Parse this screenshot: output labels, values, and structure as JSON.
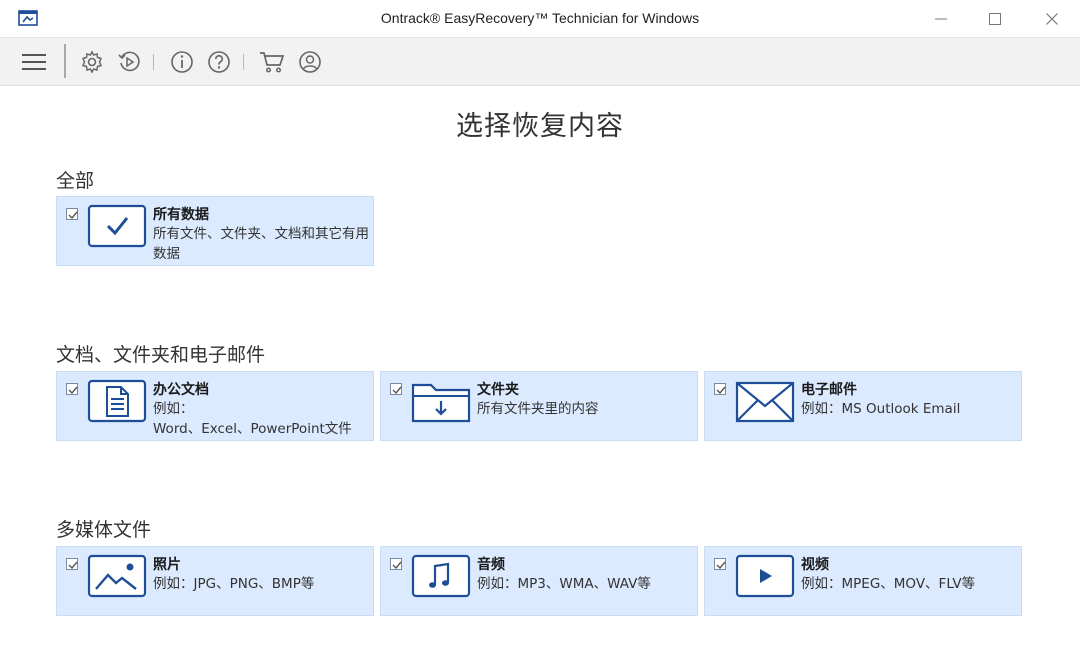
{
  "window": {
    "title": "Ontrack® EasyRecovery™ Technician for Windows"
  },
  "toolbar": {
    "items": [
      "menu-icon",
      "settings-icon",
      "history-icon",
      "info-icon",
      "help-icon",
      "cart-icon",
      "account-icon"
    ]
  },
  "page": {
    "title": "选择恢复内容"
  },
  "sections": [
    {
      "title": "全部",
      "cards": [
        {
          "title": "所有数据",
          "desc": "所有文件、文件夹、文档和其它有用数据",
          "checked": true,
          "icon": "check-icon"
        }
      ]
    },
    {
      "title": "文档、文件夹和电子邮件",
      "cards": [
        {
          "title": "办公文档",
          "desc_line1": "例如：",
          "desc_line2": "Word、Excel、PowerPoint文件",
          "checked": true,
          "icon": "document-icon"
        },
        {
          "title": "文件夹",
          "desc": "所有文件夹里的内容",
          "checked": true,
          "icon": "folder-icon"
        },
        {
          "title": "电子邮件",
          "desc": "例如：MS Outlook Email",
          "checked": true,
          "icon": "envelope-icon"
        }
      ]
    },
    {
      "title": "多媒体文件",
      "cards": [
        {
          "title": "照片",
          "desc": "例如：JPG、PNG、BMP等",
          "checked": true,
          "icon": "image-icon"
        },
        {
          "title": "音频",
          "desc": "例如：MP3、WMA、WAV等",
          "checked": true,
          "icon": "music-icon"
        },
        {
          "title": "视频",
          "desc": "例如：MPEG、MOV、FLV等",
          "checked": true,
          "icon": "play-icon"
        }
      ]
    }
  ],
  "colors": {
    "card_bg": "#dbeafe",
    "icon_blue": "#1f4e99",
    "toolbar_bg": "#f2f2f2"
  }
}
